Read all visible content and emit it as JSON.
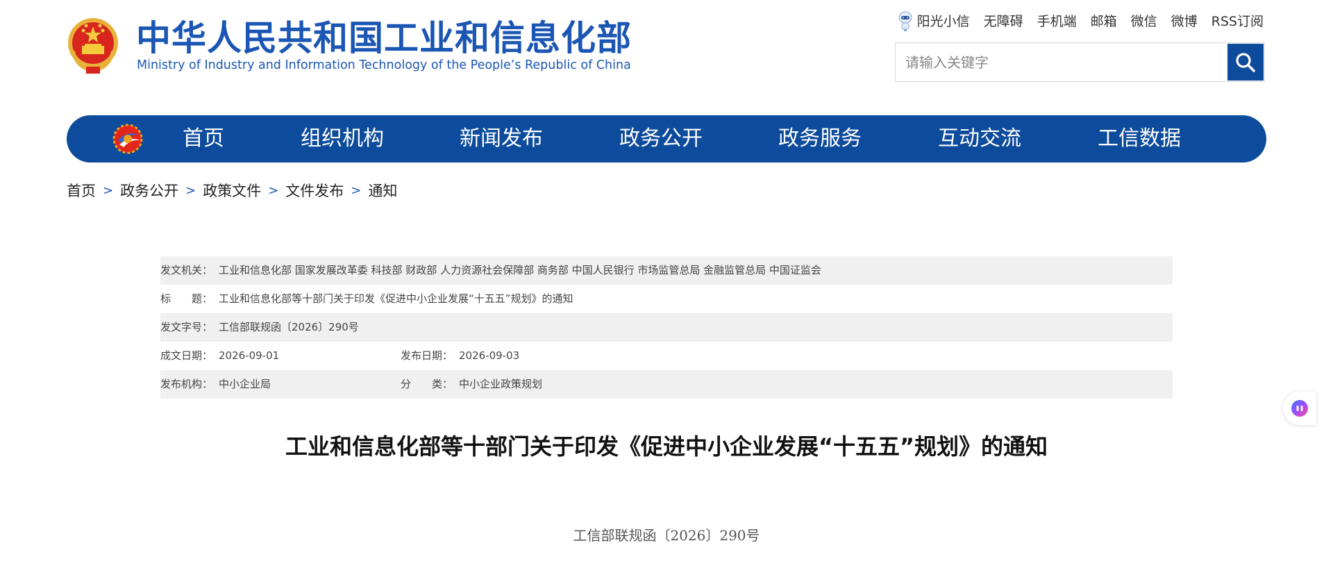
{
  "header": {
    "site_title": "中华人民共和国工业和信息化部",
    "site_subtitle": "Ministry of Industry and Information Technology of the People’s Republic of China"
  },
  "toplinks": [
    {
      "label": "阳光小信",
      "icon": "robot-icon"
    },
    {
      "label": "无障碍"
    },
    {
      "label": "手机端"
    },
    {
      "label": "邮箱"
    },
    {
      "label": "微信"
    },
    {
      "label": "微博"
    },
    {
      "label": "RSS订阅"
    }
  ],
  "search": {
    "placeholder": "请输入关键字",
    "icon": "search-icon"
  },
  "nav": {
    "items": [
      "首页",
      "组织机构",
      "新闻发布",
      "政务公开",
      "政务服务",
      "互动交流",
      "工信数据"
    ]
  },
  "breadcrumb": {
    "items": [
      "首页",
      "政务公开",
      "政策文件",
      "文件发布",
      "通知"
    ],
    "separator": ">"
  },
  "info": {
    "issuer_label": "发文机关：",
    "issuer_value": "工业和信息化部 国家发展改革委 科技部 财政部 人力资源社会保障部 商务部 中国人民银行 市场监管总局 金融监管总局 中国证监会",
    "title_label": "标　　题：",
    "title_value": "工业和信息化部等十部门关于印发《促进中小企业发展“十五五”规划》的通知",
    "docno_label": "发文字号：",
    "docno_value": "工信部联规函〔2026〕290号",
    "created_label": "成文日期：",
    "created_value": "2026-09-01",
    "published_label": "发布日期：",
    "published_value": "2026-09-03",
    "org_label": "发布机构：",
    "org_value": "中小企业局",
    "category_label": "分　　类：",
    "category_value": "中小企业政策规划"
  },
  "article": {
    "title": "工业和信息化部等十部门关于印发《促进中小企业发展“十五五”规划》的通知",
    "doc_number": "工信部联规函〔2026〕290号"
  },
  "colors": {
    "brand_blue": "#1b56b4",
    "nav_blue": "#0d4b9c",
    "row_shade": "#f0f0f0"
  }
}
